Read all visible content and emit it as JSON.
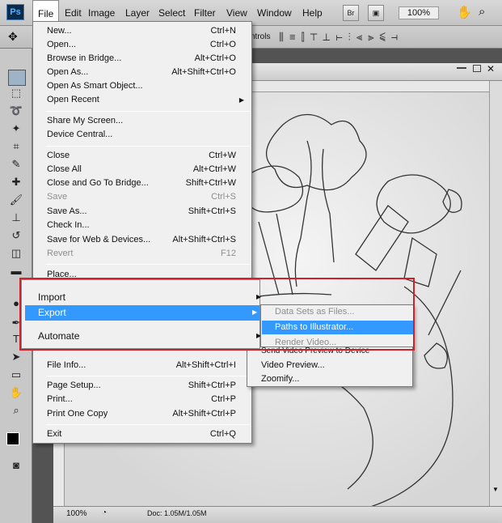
{
  "app": {
    "logo": "Ps"
  },
  "menubar": {
    "items": [
      "File",
      "Edit",
      "Image",
      "Layer",
      "Select",
      "Filter",
      "View",
      "Window",
      "Help"
    ],
    "bridge": "Br",
    "zoom": "100%"
  },
  "options_bar": {
    "label": "ntrols"
  },
  "file_menu": {
    "items": [
      {
        "label": "New...",
        "shortcut": "Ctrl+N"
      },
      {
        "label": "Open...",
        "shortcut": "Ctrl+O"
      },
      {
        "label": "Browse in Bridge...",
        "shortcut": "Alt+Ctrl+O"
      },
      {
        "label": "Open As...",
        "shortcut": "Alt+Shift+Ctrl+O"
      },
      {
        "label": "Open As Smart Object...",
        "shortcut": ""
      },
      {
        "label": "Open Recent",
        "shortcut": ""
      },
      {
        "label": "Share My Screen...",
        "shortcut": ""
      },
      {
        "label": "Device Central...",
        "shortcut": ""
      },
      {
        "label": "Close",
        "shortcut": "Ctrl+W"
      },
      {
        "label": "Close All",
        "shortcut": "Alt+Ctrl+W"
      },
      {
        "label": "Close and Go To Bridge...",
        "shortcut": "Shift+Ctrl+W"
      },
      {
        "label": "Save",
        "shortcut": "Ctrl+S"
      },
      {
        "label": "Save As...",
        "shortcut": "Shift+Ctrl+S"
      },
      {
        "label": "Check In...",
        "shortcut": ""
      },
      {
        "label": "Save for Web & Devices...",
        "shortcut": "Alt+Shift+Ctrl+S"
      },
      {
        "label": "Revert",
        "shortcut": "F12"
      },
      {
        "label": "Place...",
        "shortcut": ""
      },
      {
        "label": "File Info...",
        "shortcut": "Alt+Shift+Ctrl+I"
      },
      {
        "label": "Page Setup...",
        "shortcut": "Shift+Ctrl+P"
      },
      {
        "label": "Print...",
        "shortcut": "Ctrl+P"
      },
      {
        "label": "Print One Copy",
        "shortcut": "Alt+Shift+Ctrl+P"
      },
      {
        "label": "Exit",
        "shortcut": "Ctrl+Q"
      }
    ]
  },
  "zoomed_menu": {
    "import": "Import",
    "export": "Export",
    "automate": "Automate"
  },
  "export_submenu": {
    "items": [
      "Data Sets as Files...",
      "Paths to Illustrator...",
      "Render Video...",
      "Send Video Preview to Device",
      "Video Preview...",
      "Zoomify..."
    ]
  },
  "status": {
    "zoom": "100%",
    "doc": "Doc: 1.05M/1.05M"
  },
  "colors": {
    "highlight": "#3399ff",
    "callout": "#d0202a"
  }
}
